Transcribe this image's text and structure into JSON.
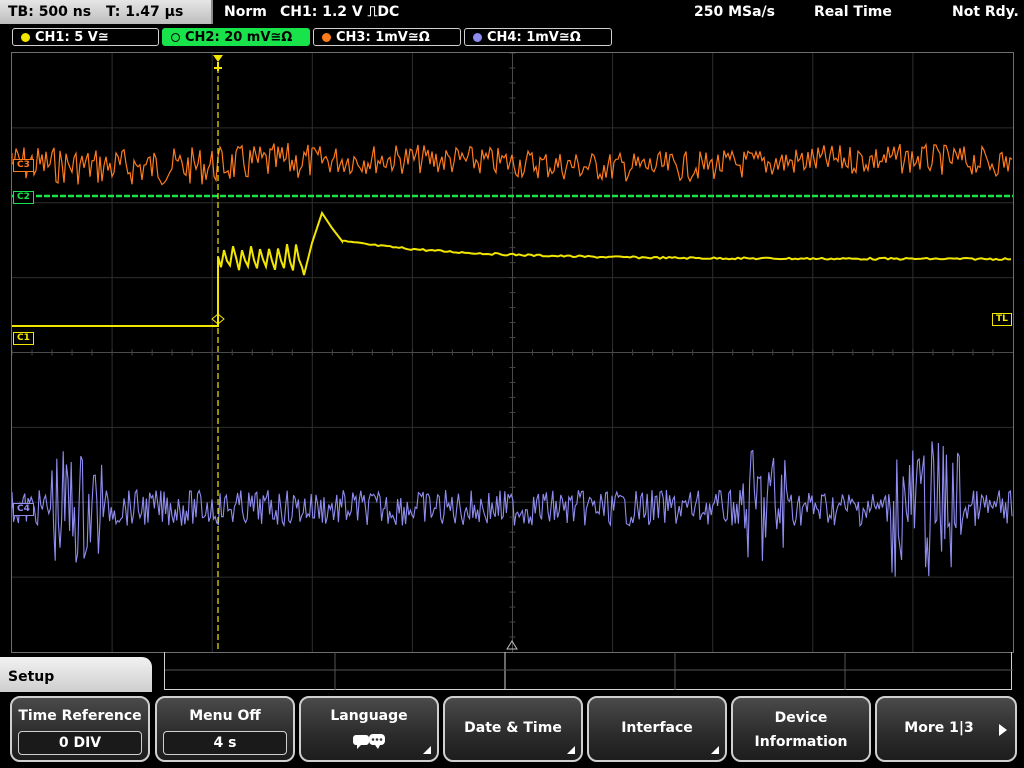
{
  "status": {
    "timebase": "TB: 500 ns",
    "trigger_time": "T: 1.47 µs",
    "mode": "Norm",
    "trigger_source": "CH1: 1.2 V ⎍DC",
    "sample_rate": "250 MSa/s",
    "acq_mode": "Real Time",
    "trigger_state": "Not Rdy."
  },
  "channels": [
    {
      "label": "CH1: 5 V≅",
      "color": "#f2e600",
      "marker": "C1"
    },
    {
      "label": "CH2: 20 mV≅Ω",
      "color": "#19e34a",
      "marker": "C2"
    },
    {
      "label": "CH3: 1mV≅Ω",
      "color": "#ff7b1c",
      "marker": "C3"
    },
    {
      "label": "CH4: 1mV≅Ω",
      "color": "#8f8cf0",
      "marker": "C4"
    }
  ],
  "trigger_level_marker": "TL",
  "menu": {
    "title": "Setup",
    "buttons": [
      {
        "label": "Time Reference",
        "value": "0 DIV"
      },
      {
        "label": "Menu Off",
        "value": "4 s"
      },
      {
        "label": "Language",
        "icon": "language-icon"
      },
      {
        "label": "Date & Time"
      },
      {
        "label": "Interface"
      },
      {
        "label": "Device",
        "label2": "Information"
      },
      {
        "label": "More 1|3"
      }
    ]
  },
  "colors": {
    "ch1": "#f2e600",
    "ch2": "#19e34a",
    "ch3": "#ff7b1c",
    "ch4": "#8f8cf0"
  }
}
